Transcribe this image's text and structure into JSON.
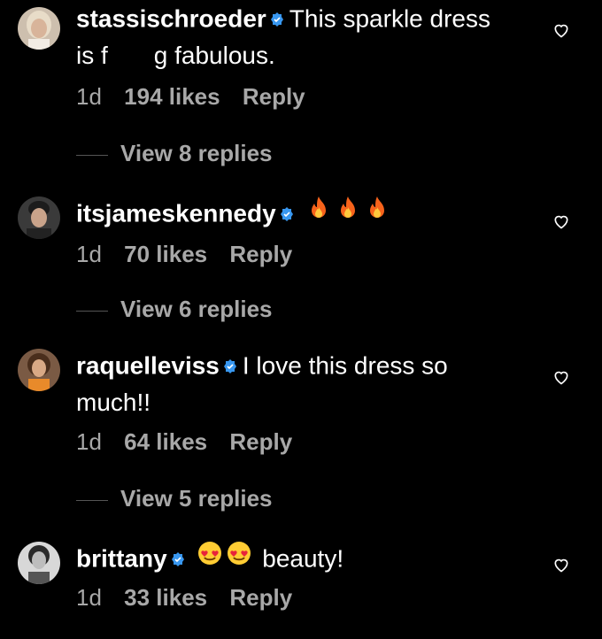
{
  "comments": [
    {
      "username": "stassischroeder",
      "verified": true,
      "text": "This sparkle dress is f",
      "text_after_redaction": "g fabulous.",
      "time": "1d",
      "likes": "194 likes",
      "reply": "Reply",
      "view_replies": "View 8 replies",
      "avatar_icon": "avatar-photo-blonde"
    },
    {
      "username": "itsjameskennedy",
      "verified": true,
      "emojis": [
        "fire",
        "fire",
        "fire"
      ],
      "time": "1d",
      "likes": "70 likes",
      "reply": "Reply",
      "view_replies": "View 6 replies",
      "avatar_icon": "avatar-photo-dark-hair"
    },
    {
      "username": "raquelleviss",
      "verified": true,
      "text": "I love this dress so much!!",
      "time": "1d",
      "likes": "64 likes",
      "reply": "Reply",
      "view_replies": "View 5 replies",
      "avatar_icon": "avatar-photo-orange"
    },
    {
      "username": "brittany",
      "verified": true,
      "emojis": [
        "heart-eyes",
        "heart-eyes"
      ],
      "text": "beauty!",
      "time": "1d",
      "likes": "33 likes",
      "reply": "Reply",
      "avatar_icon": "avatar-photo-bw"
    }
  ],
  "colors": {
    "background": "#000000",
    "primary_text": "#ffffff",
    "secondary_text": "#a8a8a8",
    "verified_badge": "#3897f0"
  }
}
